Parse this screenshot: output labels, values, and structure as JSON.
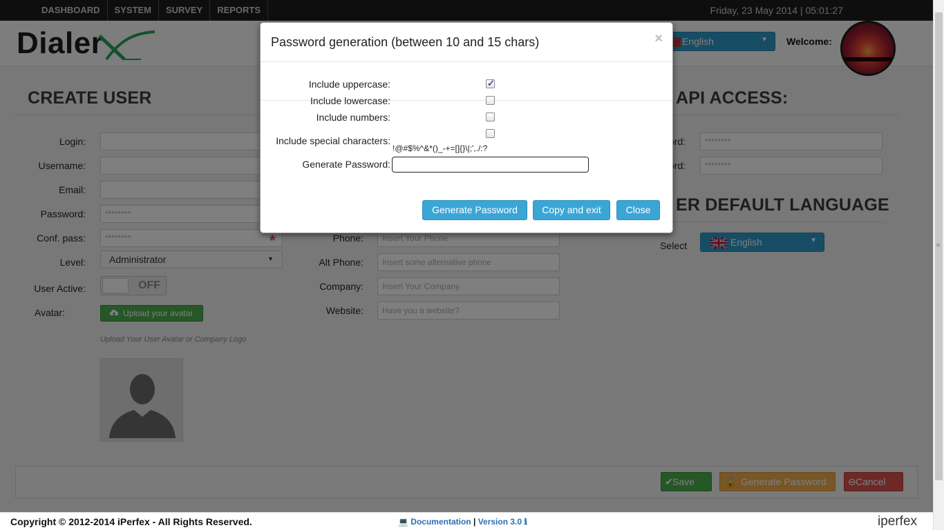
{
  "topnav": {
    "items": [
      "DASHBOARD",
      "SYSTEM",
      "SURVEY",
      "REPORTS"
    ],
    "datetime": "Friday, 23 May 2014 | 05:01:27"
  },
  "header": {
    "logo_text": "Dialer",
    "language": "English",
    "welcome": "Welcome:"
  },
  "create_user": {
    "title": "CREATE USER",
    "fields": {
      "login": {
        "label": "Login:"
      },
      "username": {
        "label": "Username:"
      },
      "email": {
        "label": "Email:"
      },
      "password": {
        "label": "Password:",
        "value": "********"
      },
      "conf_pass": {
        "label": "Conf. pass:",
        "value": "********"
      },
      "level": {
        "label": "Level:",
        "value": "Administrator"
      },
      "user_active": {
        "label": "User Active:",
        "toggle": "OFF"
      },
      "avatar": {
        "label": "Avatar:",
        "button": "Upload your avatar",
        "hint": "Upload Your User Avatar or Company Logo"
      }
    }
  },
  "contact": {
    "phone": {
      "label": "Phone:",
      "placeholder": "Insert Your Phone"
    },
    "alt_phone": {
      "label": "Alt Phone:",
      "placeholder": "Insert some alternative phone"
    },
    "company": {
      "label": "Company:",
      "placeholder": "Insert Your Company"
    },
    "website": {
      "label": "Website:",
      "placeholder": "Have you a website?"
    }
  },
  "api_access": {
    "title": "API ACCESS:",
    "label1": "ord:",
    "value1": "********",
    "label2": "ord:",
    "value2": "********"
  },
  "default_language": {
    "title": "ER DEFAULT LANGUAGE",
    "select_label": "Select",
    "value": "English"
  },
  "actions": {
    "save": "Save",
    "generate": "Generate Password",
    "cancel": "Cancel"
  },
  "footer": {
    "copyright": "Copyright © 2012-2014 iPerfex - All Rights Reserved.",
    "docs": "Documentation",
    "version": "Version 3.0",
    "brand": "iperfex"
  },
  "modal": {
    "title": "Password generation (between 10 and 15 chars)",
    "close": "×",
    "options": [
      {
        "label": "Include uppercase:",
        "checked": true
      },
      {
        "label": "Include lowercase:",
        "checked": false
      },
      {
        "label": "Include numbers:",
        "checked": false
      },
      {
        "label": "Include special characters:",
        "checked": false
      }
    ],
    "special_chars": "!@#$%^&*()_-+=[]{}\\|;',./:?",
    "generate_label": "Generate Password:",
    "generate_value": "",
    "buttons": {
      "generate": "Generate Password",
      "copy": "Copy and exit",
      "close": "Close"
    }
  },
  "colors": {
    "primary": "#3ba6d6",
    "success": "#4cae4c",
    "warning": "#f0ad4e",
    "danger": "#d9534f",
    "topbar": "#1c1c1c"
  }
}
